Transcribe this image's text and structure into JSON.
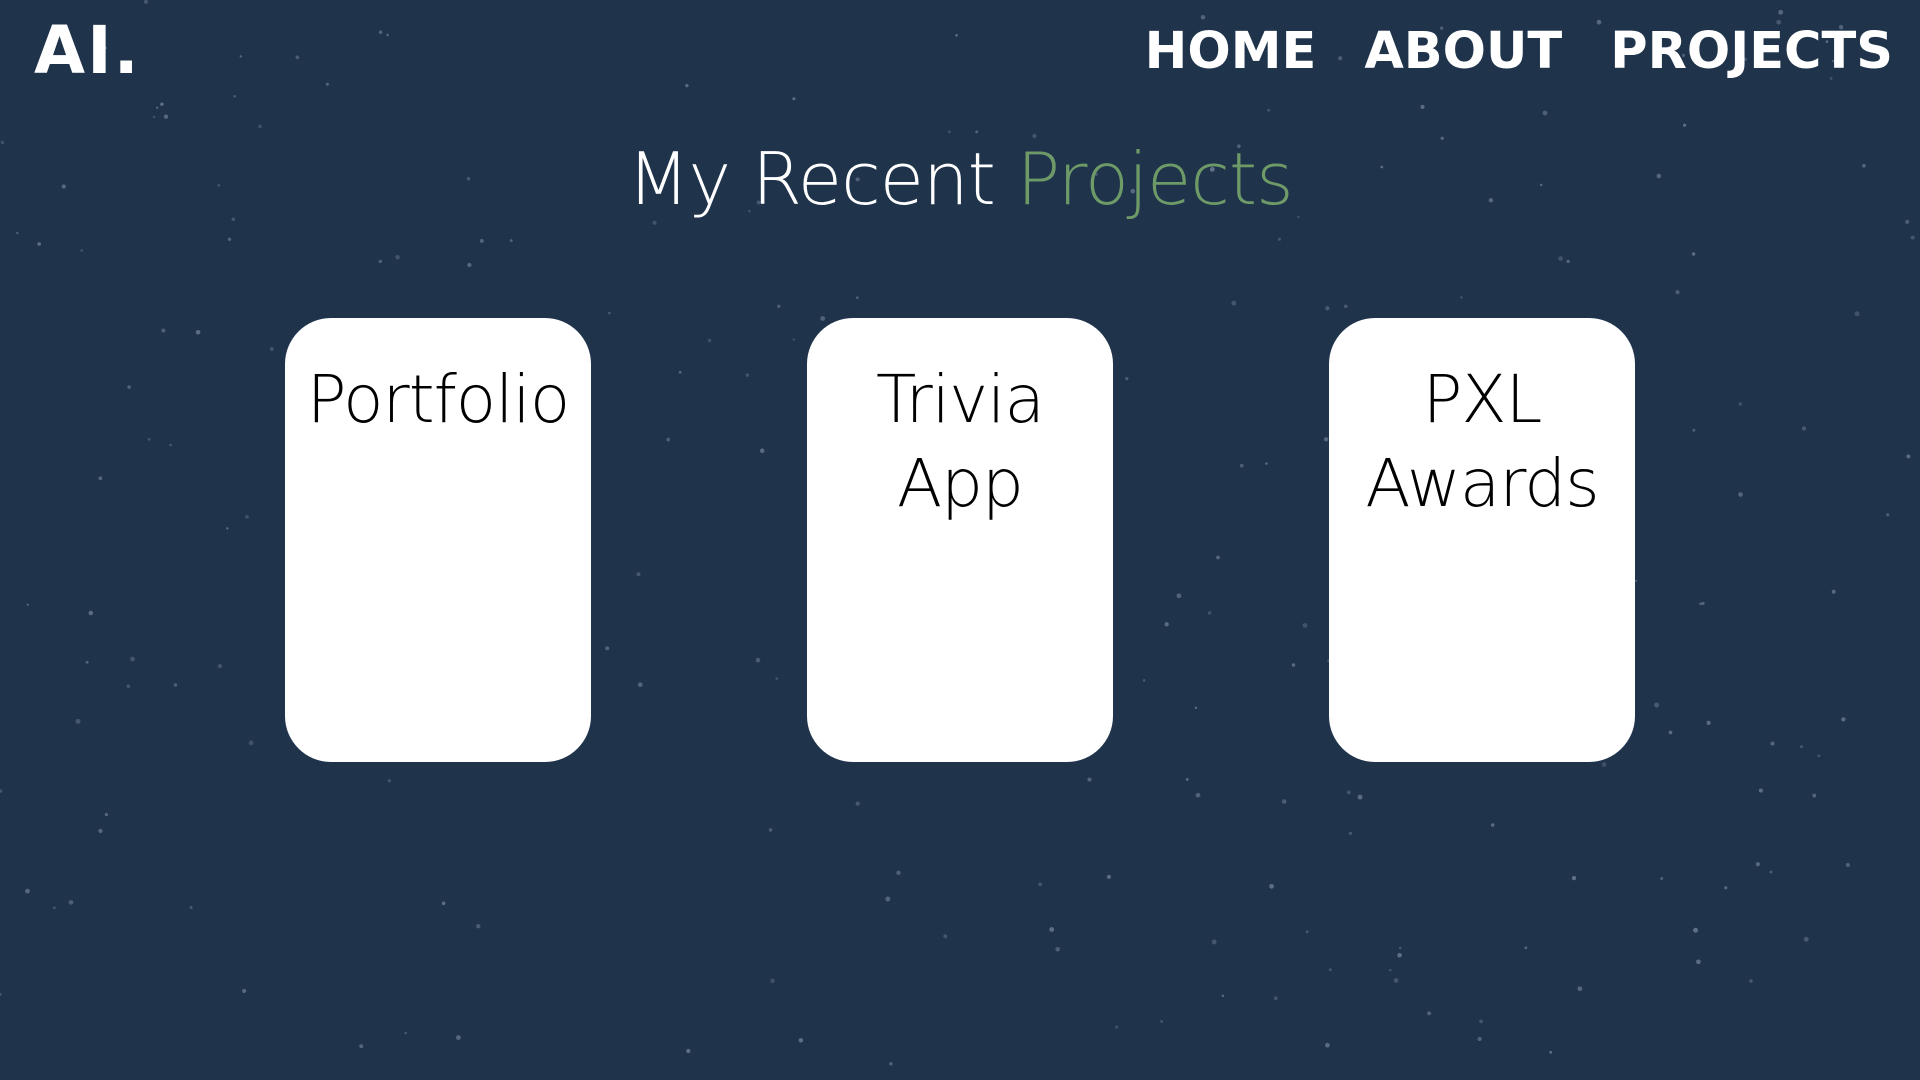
{
  "header": {
    "logo_text": "AI.",
    "nav": {
      "home_label": "HOME",
      "about_label": "ABOUT",
      "projects_label": "PROJECTS"
    }
  },
  "main": {
    "heading_main": "My Recent ",
    "heading_accent": "Projects",
    "projects": [
      {
        "title": "Portfolio"
      },
      {
        "title": "Trivia App"
      },
      {
        "title": "PXL Awards"
      }
    ]
  },
  "colors": {
    "background": "#1f334b",
    "accent": "#6e9a68",
    "card": "#ffffff",
    "text_light": "#ffffff",
    "text_dark": "#000000"
  }
}
